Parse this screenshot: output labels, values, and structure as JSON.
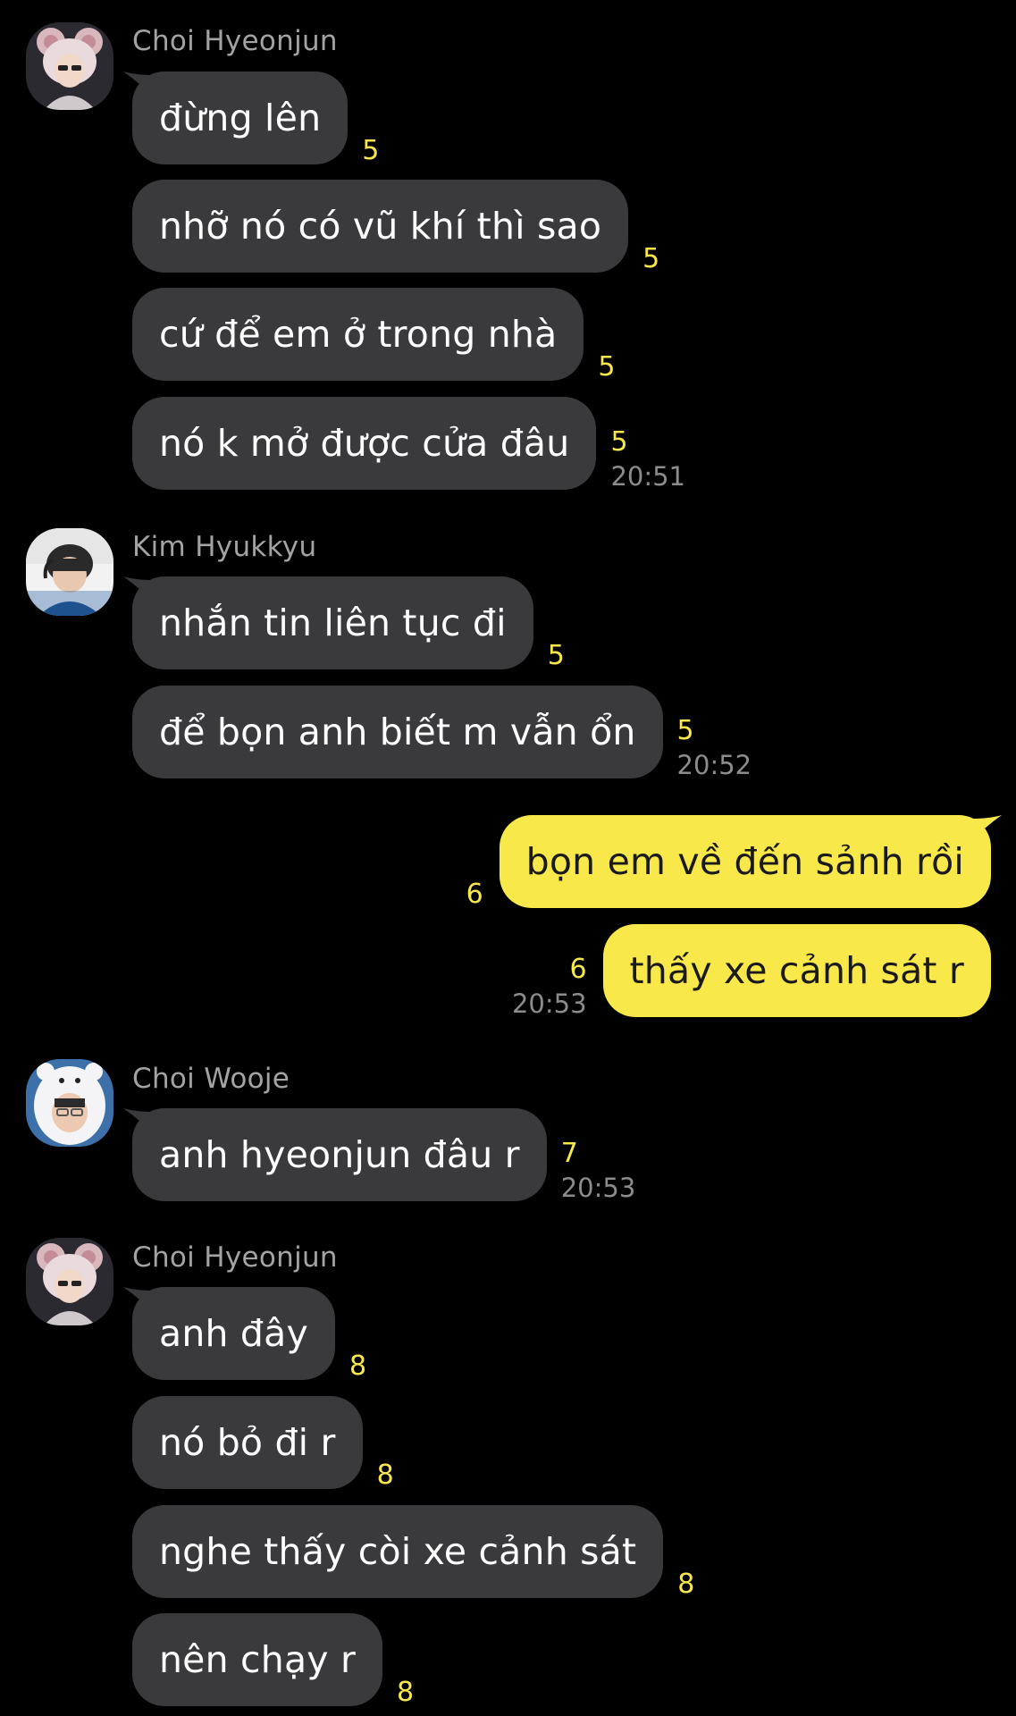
{
  "colors": {
    "background": "#000000",
    "incoming_bubble": "#3a3a3c",
    "outgoing_bubble": "#f8e84a",
    "unread_count": "#f8e84a",
    "sender_name": "#a3a3a3",
    "timestamp": "#8c8c8c"
  },
  "groups": [
    {
      "sender": "Choi Hyeonjun",
      "avatar_icon": "avatar-choi-hyeonjun",
      "messages": [
        {
          "text": "đừng lên",
          "unread": "5"
        },
        {
          "text": "nhỡ nó có vũ khí thì sao",
          "unread": "5"
        },
        {
          "text": "cứ để em ở trong nhà",
          "unread": "5"
        },
        {
          "text": "nó k mở được cửa đâu",
          "unread": "5",
          "time": "20:51"
        }
      ]
    },
    {
      "sender": "Kim Hyukkyu",
      "avatar_icon": "avatar-kim-hyukkyu",
      "messages": [
        {
          "text": "nhắn tin liên tục đi",
          "unread": "5"
        },
        {
          "text": "để bọn anh biết m vẫn ổn",
          "unread": "5",
          "time": "20:52"
        }
      ]
    },
    {
      "sender": "",
      "outgoing": true,
      "messages": [
        {
          "text": "bọn em về đến sảnh rồi",
          "unread": "6"
        },
        {
          "text": "thấy xe cảnh sát r",
          "unread": "6",
          "time": "20:53"
        }
      ]
    },
    {
      "sender": "Choi Wooje",
      "avatar_icon": "avatar-choi-wooje",
      "messages": [
        {
          "text": "anh hyeonjun đâu r",
          "unread": "7",
          "time": "20:53"
        }
      ]
    },
    {
      "sender": "Choi Hyeonjun",
      "avatar_icon": "avatar-choi-hyeonjun",
      "messages": [
        {
          "text": "anh đây",
          "unread": "8"
        },
        {
          "text": "nó bỏ đi r",
          "unread": "8"
        },
        {
          "text": "nghe thấy còi xe cảnh sát",
          "unread": "8"
        },
        {
          "text": "nên chạy r",
          "unread": "8"
        }
      ]
    }
  ]
}
